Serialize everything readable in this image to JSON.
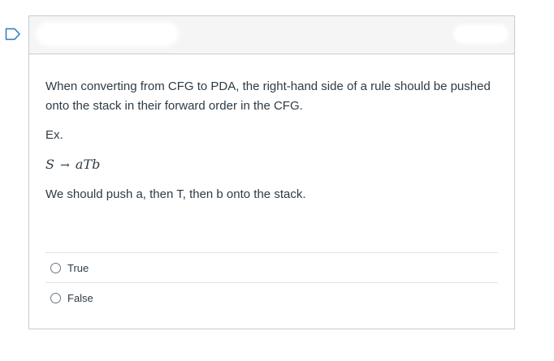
{
  "question": {
    "paragraph1": "When converting from CFG to PDA, the right-hand side of a rule should be pushed onto the stack in their forward order in the CFG.",
    "example_label": "Ex.",
    "formula": {
      "lhs": "S",
      "arrow": "→",
      "rhs": "aTb"
    },
    "paragraph2": "We should push a, then T, then b onto the stack."
  },
  "answers": [
    {
      "label": "True"
    },
    {
      "label": "False"
    }
  ],
  "colors": {
    "flag": "#2b7abc",
    "border": "#c7cdd1",
    "header_bg": "#f5f5f5",
    "text": "#2d3b45"
  },
  "icons": {
    "flag": "bookmark-flag-icon"
  }
}
